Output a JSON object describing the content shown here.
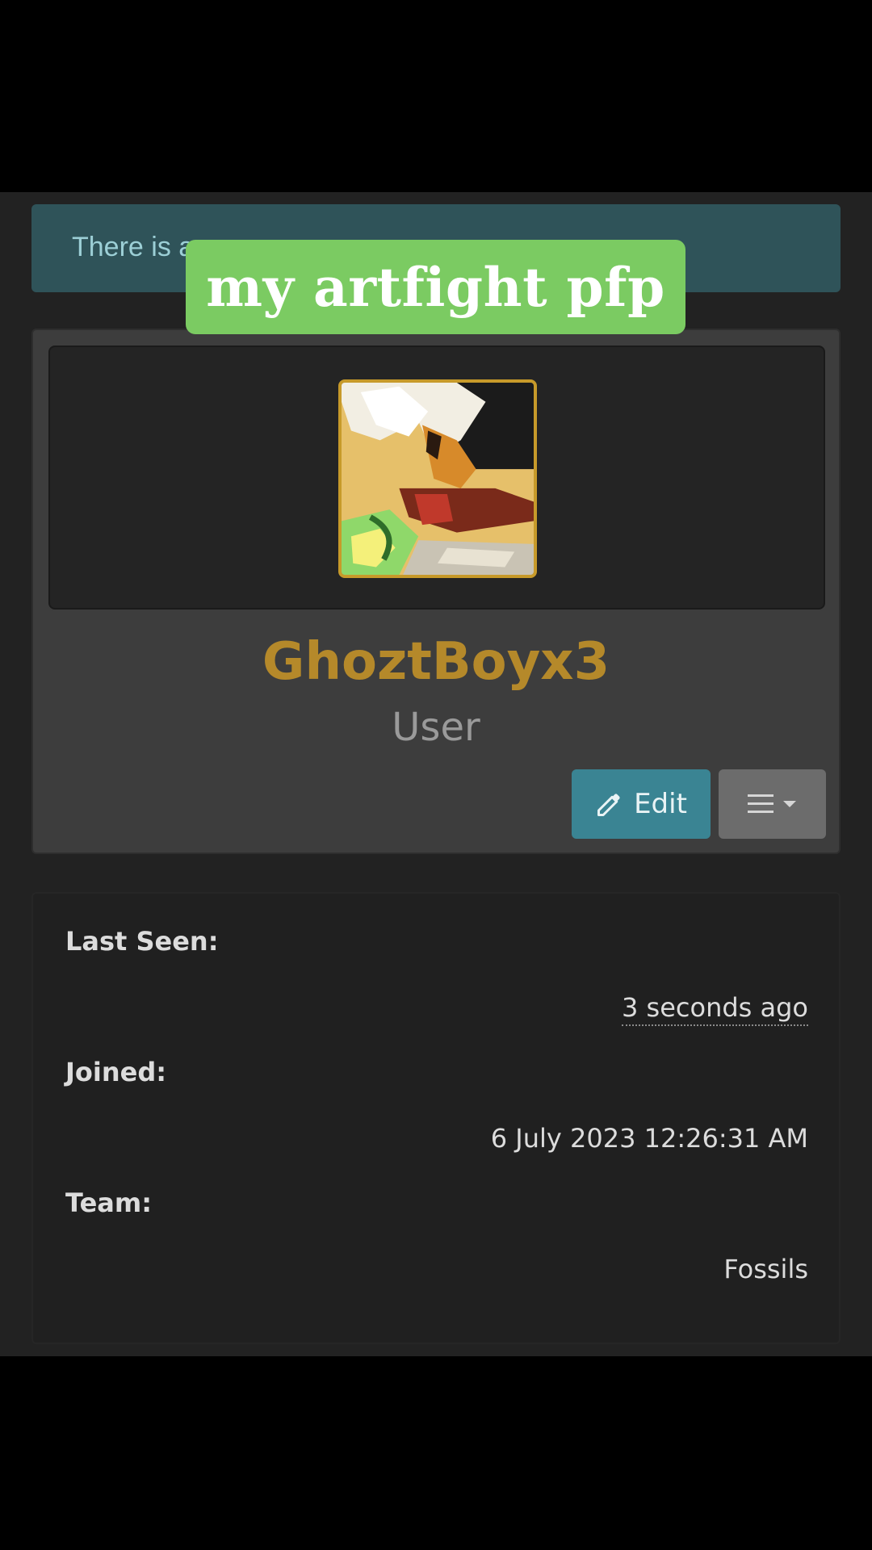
{
  "alert": {
    "text": "There is a"
  },
  "overlay": {
    "caption": "my artfight pfp"
  },
  "profile": {
    "avatar_icon": "avatar-image",
    "username": "GhoztBoyx3",
    "role": "User",
    "username_color": "#b5892a",
    "edit_label": "Edit",
    "edit_icon": "pencil-icon",
    "menu_icon": "hamburger-icon",
    "caret_icon": "caret-down-icon"
  },
  "info": {
    "last_seen_label": "Last Seen:",
    "last_seen_value": "3 seconds ago",
    "joined_label": "Joined:",
    "joined_value": "6 July 2023 12:26:31 AM",
    "team_label": "Team:",
    "team_value": "Fossils"
  },
  "colors": {
    "accent": "#3a8493",
    "alert_bg": "#2f5359",
    "caption_bg": "#7bcb62"
  }
}
